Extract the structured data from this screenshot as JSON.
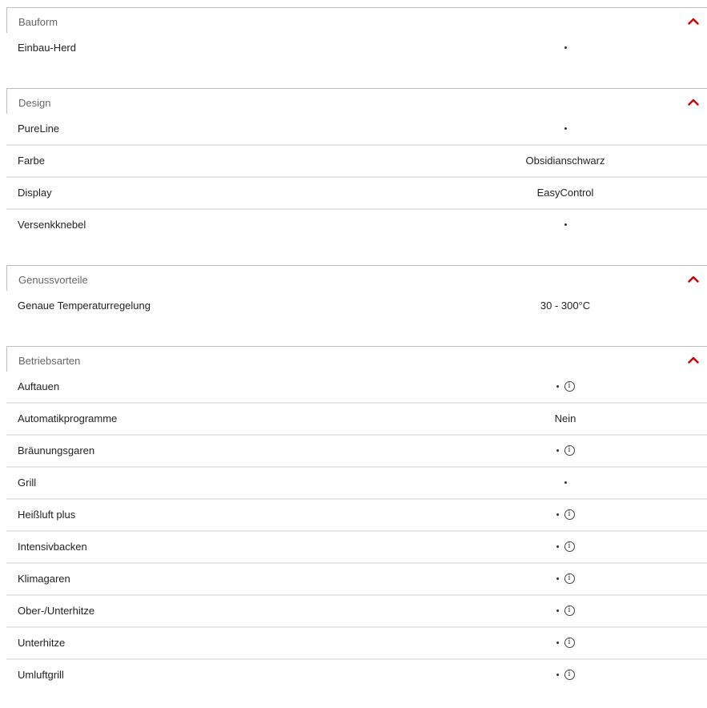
{
  "accent_color": "#cc0000",
  "icons": {
    "collapse": "chevron-up-icon",
    "info": "info-icon",
    "available": "bullet-dot"
  },
  "sections": [
    {
      "title": "Bauform",
      "rows": [
        {
          "label": "Einbau-Herd",
          "value": "•",
          "info": false
        }
      ]
    },
    {
      "title": "Design",
      "rows": [
        {
          "label": "PureLine",
          "value": "•",
          "info": false
        },
        {
          "label": "Farbe",
          "value": "Obsidianschwarz",
          "info": false
        },
        {
          "label": "Display",
          "value": "EasyControl",
          "info": false
        },
        {
          "label": "Versenkknebel",
          "value": "•",
          "info": false
        }
      ]
    },
    {
      "title": "Genussvorteile",
      "rows": [
        {
          "label": "Genaue Temperaturregelung",
          "value": "30 - 300°C",
          "info": false
        }
      ]
    },
    {
      "title": "Betriebsarten",
      "rows": [
        {
          "label": "Auftauen",
          "value": "•",
          "info": true
        },
        {
          "label": "Automatikprogramme",
          "value": "Nein",
          "info": false
        },
        {
          "label": "Bräunungsgaren",
          "value": "•",
          "info": true
        },
        {
          "label": "Grill",
          "value": "•",
          "info": false
        },
        {
          "label": "Heißluft plus",
          "value": "•",
          "info": true
        },
        {
          "label": "Intensivbacken",
          "value": "•",
          "info": true
        },
        {
          "label": "Klimagaren",
          "value": "•",
          "info": true
        },
        {
          "label": "Ober-/Unterhitze",
          "value": "•",
          "info": true
        },
        {
          "label": "Unterhitze",
          "value": "•",
          "info": true
        },
        {
          "label": "Umluftgrill",
          "value": "•",
          "info": true
        }
      ]
    }
  ]
}
